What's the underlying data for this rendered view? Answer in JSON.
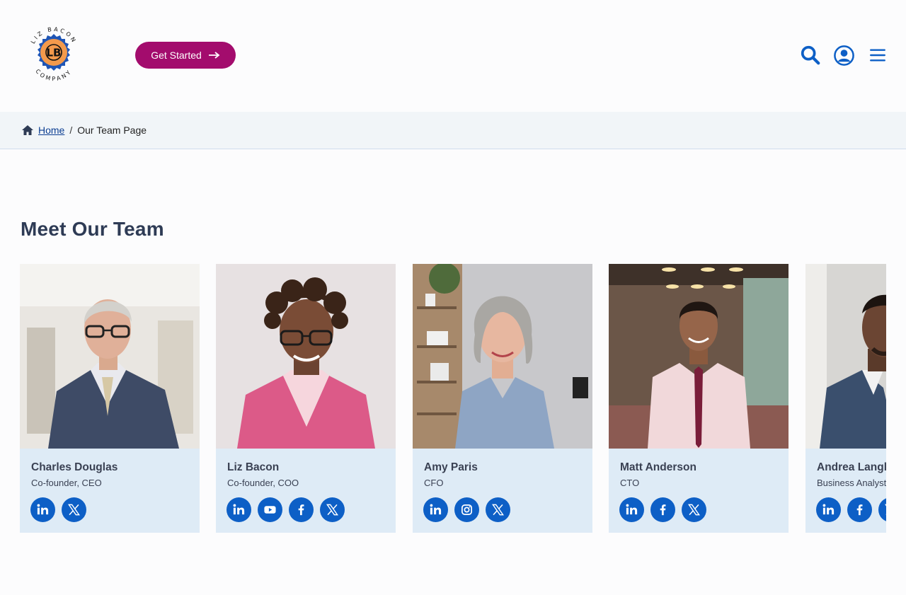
{
  "header": {
    "logo_top_text": "LIZ BACON",
    "logo_bottom_text": "COMPANY",
    "logo_initials": "LB",
    "cta_label": "Get Started",
    "icons": [
      "search-icon",
      "account-icon",
      "hamburger-menu-icon"
    ]
  },
  "breadcrumb": {
    "home_label": "Home",
    "separator": "/",
    "current": "Our Team Page"
  },
  "section": {
    "title": "Meet Our Team"
  },
  "team": [
    {
      "name": "Charles Douglas",
      "role": "Co-founder, CEO",
      "socials": [
        "linkedin",
        "x"
      ]
    },
    {
      "name": "Liz Bacon",
      "role": "Co-founder, COO",
      "socials": [
        "linkedin",
        "youtube",
        "facebook",
        "x"
      ]
    },
    {
      "name": "Amy Paris",
      "role": "CFO",
      "socials": [
        "linkedin",
        "instagram",
        "x"
      ]
    },
    {
      "name": "Matt Anderson",
      "role": "CTO",
      "socials": [
        "linkedin",
        "facebook",
        "x"
      ]
    },
    {
      "name": "Andrea Langley",
      "role": "Business Analyst",
      "socials": [
        "linkedin",
        "facebook",
        "x"
      ]
    }
  ],
  "colors": {
    "brand_magenta": "#a30c6d",
    "icon_blue": "#0d5fc6",
    "heading": "#2e3b55",
    "card_bg": "#deebf6",
    "logo_orange": "#f39a4c",
    "logo_blue": "#1f55b5"
  }
}
